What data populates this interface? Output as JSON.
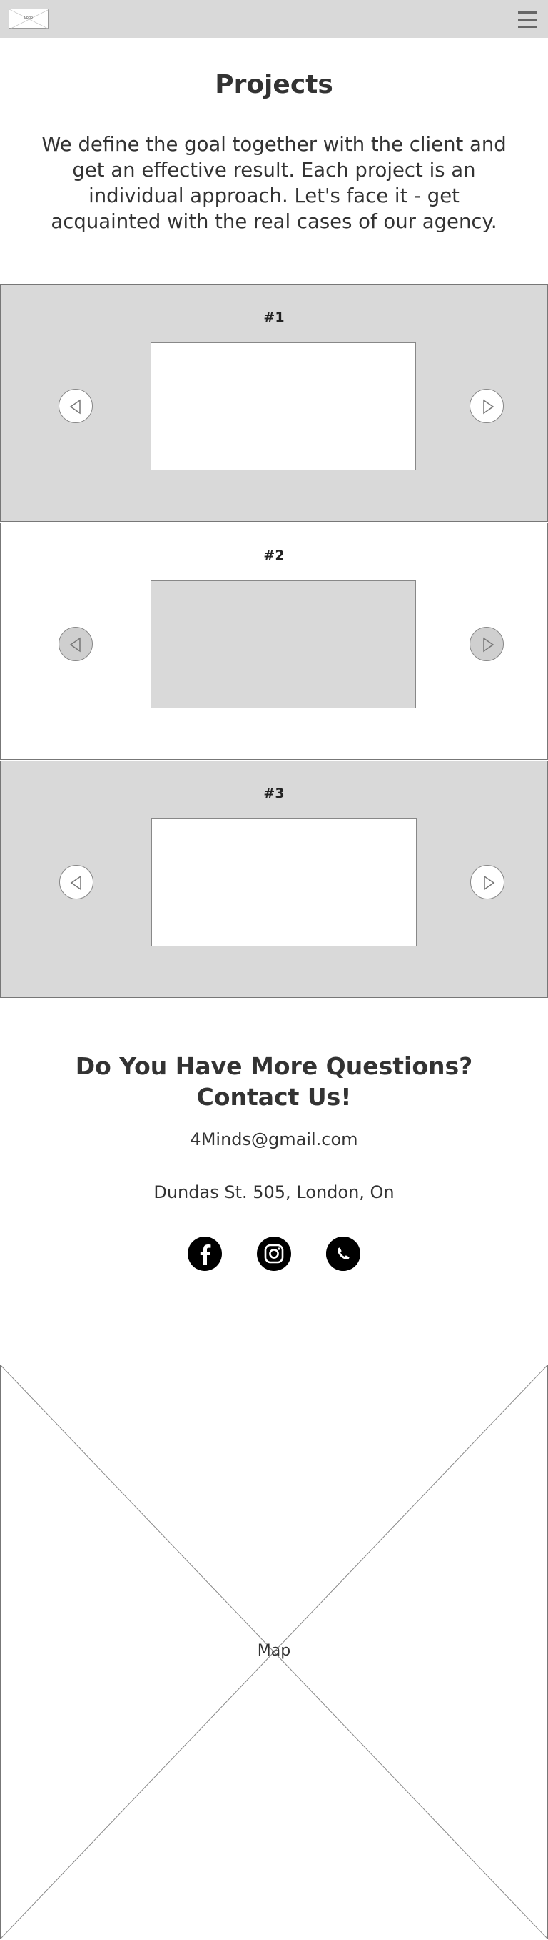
{
  "header": {
    "logo_text": "Logo"
  },
  "projects_section": {
    "title": "Projects",
    "description": "We define the goal together with the client and get an effective result. Each project is an individual approach. Let's face it - get acquainted with the real cases of our agency."
  },
  "projects": [
    {
      "label": "#1"
    },
    {
      "label": "#2"
    },
    {
      "label": "#3"
    }
  ],
  "contact": {
    "title_line1": "Do You Have More Questions?",
    "title_line2": "Contact Us!",
    "email": "4Minds@gmail.com",
    "address": "Dundas St. 505, London, On"
  },
  "social_icons": [
    "facebook-icon",
    "instagram-icon",
    "whatsapp-icon"
  ],
  "map": {
    "label": "Map"
  },
  "colors": {
    "grey_band": "#d9d9d9",
    "border": "#777777",
    "text": "#333333"
  }
}
